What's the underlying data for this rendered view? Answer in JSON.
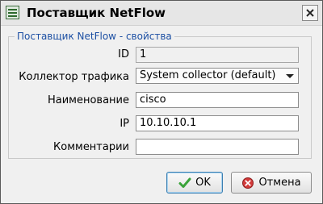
{
  "window": {
    "title": "Поставщик NetFlow",
    "icon": "list-window-icon",
    "close_icon": "close-icon"
  },
  "group": {
    "title": "Поставщик NetFlow - свойства"
  },
  "fields": {
    "id": {
      "label": "ID",
      "value": "1"
    },
    "collector": {
      "label": "Коллектор трафика",
      "value": "System collector (default)"
    },
    "name": {
      "label": "Наименование",
      "value": "cisco"
    },
    "ip": {
      "label": "IP",
      "value": "10.10.10.1"
    },
    "comment": {
      "label": "Комментарии",
      "value": ""
    }
  },
  "buttons": {
    "ok": {
      "label": "OK",
      "icon": "checkmark-icon",
      "color": "#3aa33a"
    },
    "cancel": {
      "label": "Отмена",
      "icon": "cancel-circle-icon",
      "color": "#d23a3a"
    }
  }
}
